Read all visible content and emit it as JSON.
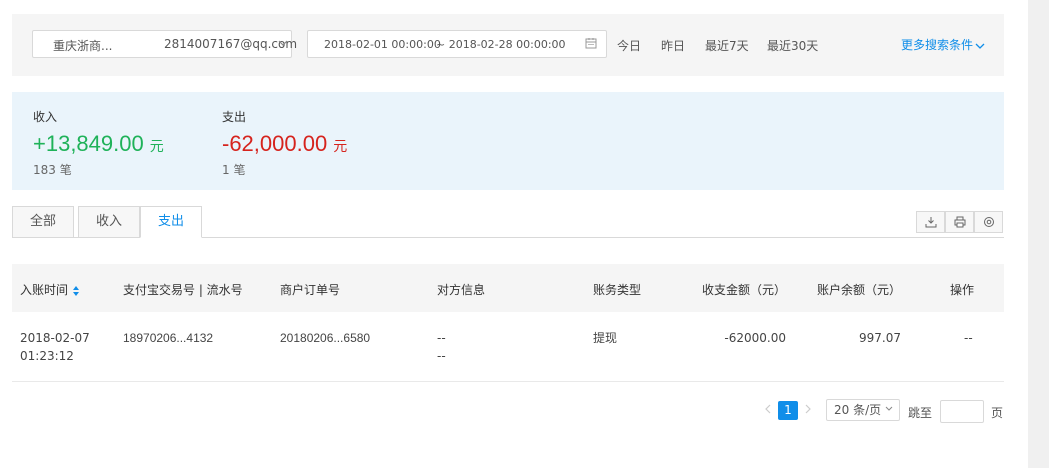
{
  "filter": {
    "account_name": "重庆浙商...",
    "account_email": "2814007167@qq.com",
    "date_start": "2018-02-01 00:00:00",
    "date_end": "~ 2018-02-28 00:00:00",
    "quick_ranges": [
      "今日",
      "昨日",
      "最近7天",
      "最近30天"
    ],
    "more_conditions": "更多搜索条件"
  },
  "summary": {
    "income": {
      "label": "收入",
      "amount": "+13,849.00",
      "unit": "元",
      "count": "183 笔"
    },
    "expense": {
      "label": "支出",
      "amount": "-62,000.00",
      "unit": "元",
      "count": "1 笔"
    }
  },
  "tabs": [
    "全部",
    "收入",
    "支出"
  ],
  "active_tab": "支出",
  "toolbar_icons": [
    "download-icon",
    "print-icon",
    "settings-icon"
  ],
  "table": {
    "columns": [
      "入账时间",
      "支付宝交易号 | 流水号",
      "商户订单号",
      "对方信息",
      "账务类型",
      "收支金额（元）",
      "账户余额（元）",
      "操作"
    ],
    "rows": [
      {
        "date": "2018-02-07",
        "time": "01:23:12",
        "trade_no": "18970206...4132",
        "order_no": "20180206...6580",
        "counterparty_1": "--",
        "counterparty_2": "--",
        "type": "提现",
        "amount": "-62000.00",
        "balance": "997.07",
        "action": "--"
      }
    ]
  },
  "pagination": {
    "current_page": "1",
    "page_size": "20 条/页",
    "jump_label": "跳至",
    "page_label": "页"
  },
  "colors": {
    "accent": "#108ee9",
    "income": "#1fb259",
    "expense": "#d6231d",
    "summary_bg": "#eaf4fb"
  }
}
